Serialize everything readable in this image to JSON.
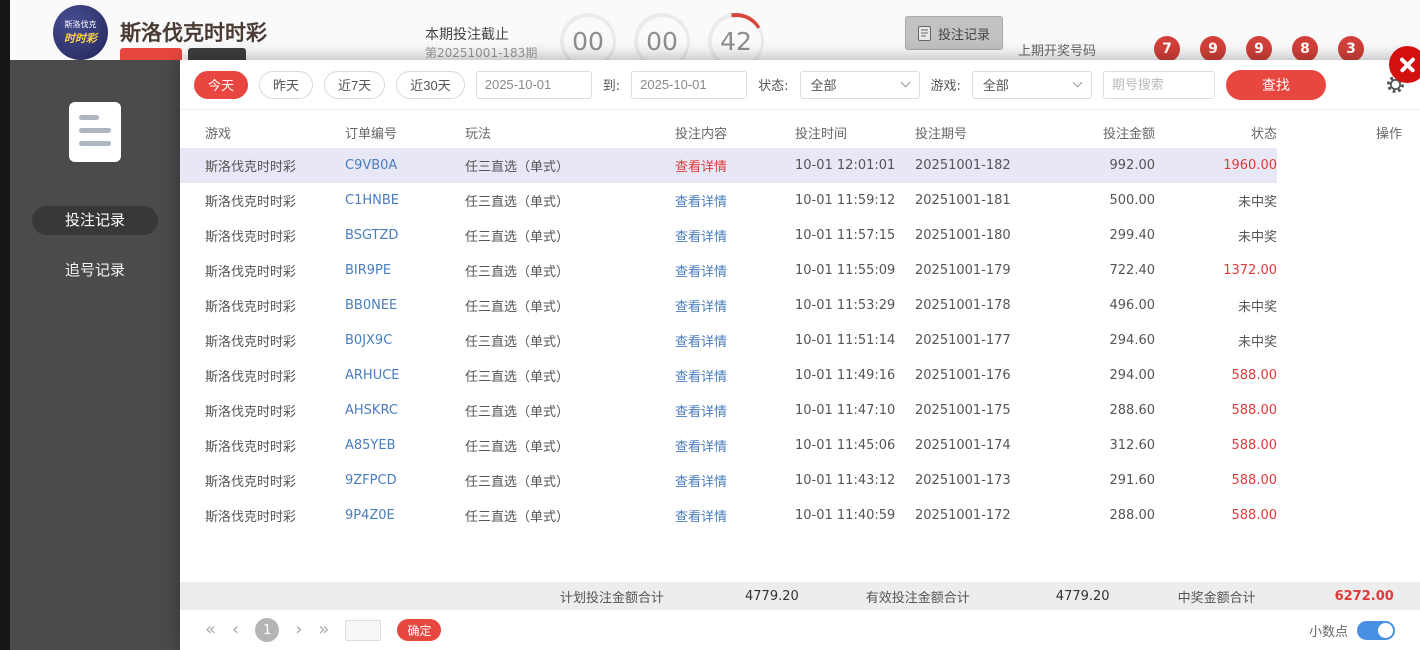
{
  "header": {
    "logo_line1": "斯洛伐克",
    "logo_line2": "时时彩",
    "title": "斯洛伐克时时彩",
    "deadline_label": "本期投注截止",
    "period_label": "第20251001-183期",
    "countdown": [
      "00",
      "00",
      "42"
    ],
    "bet_record_button": "投注记录",
    "last_draw_label": "上期开奖号码",
    "last_draw_numbers": [
      "7",
      "9",
      "9",
      "8",
      "3"
    ]
  },
  "sidebar": {
    "items": [
      {
        "label": "投注记录"
      },
      {
        "label": "追号记录"
      }
    ]
  },
  "filters": {
    "quick_buttons": [
      "今天",
      "昨天",
      "近7天",
      "近30天"
    ],
    "date_from": "2025-10-01",
    "to_label": "到:",
    "date_to": "2025-10-01",
    "status_label": "状态:",
    "status_value": "全部",
    "game_label": "游戏:",
    "game_value": "全部",
    "search_placeholder": "期号搜索",
    "search_button": "查找"
  },
  "table": {
    "columns": [
      "游戏",
      "订单编号",
      "玩法",
      "投注内容",
      "投注时间",
      "投注期号",
      "投注金额",
      "状态",
      "操作"
    ],
    "detail_link": "查看详情",
    "rows": [
      {
        "game": "斯洛伐克时时彩",
        "order": "C9VB0A",
        "play": "任三直选（单式）",
        "time": "10-01 12:01:01",
        "period": "20251001-182",
        "amount": "992.00",
        "status": "1960.00",
        "win": true,
        "highlight": true
      },
      {
        "game": "斯洛伐克时时彩",
        "order": "C1HNBE",
        "play": "任三直选（单式）",
        "time": "10-01 11:59:12",
        "period": "20251001-181",
        "amount": "500.00",
        "status": "未中奖",
        "win": false,
        "highlight": false
      },
      {
        "game": "斯洛伐克时时彩",
        "order": "BSGTZD",
        "play": "任三直选（单式）",
        "time": "10-01 11:57:15",
        "period": "20251001-180",
        "amount": "299.40",
        "status": "未中奖",
        "win": false,
        "highlight": false
      },
      {
        "game": "斯洛伐克时时彩",
        "order": "BIR9PE",
        "play": "任三直选（单式）",
        "time": "10-01 11:55:09",
        "period": "20251001-179",
        "amount": "722.40",
        "status": "1372.00",
        "win": true,
        "highlight": false
      },
      {
        "game": "斯洛伐克时时彩",
        "order": "BB0NEE",
        "play": "任三直选（单式）",
        "time": "10-01 11:53:29",
        "period": "20251001-178",
        "amount": "496.00",
        "status": "未中奖",
        "win": false,
        "highlight": false
      },
      {
        "game": "斯洛伐克时时彩",
        "order": "B0JX9C",
        "play": "任三直选（单式）",
        "time": "10-01 11:51:14",
        "period": "20251001-177",
        "amount": "294.60",
        "status": "未中奖",
        "win": false,
        "highlight": false
      },
      {
        "game": "斯洛伐克时时彩",
        "order": "ARHUCE",
        "play": "任三直选（单式）",
        "time": "10-01 11:49:16",
        "period": "20251001-176",
        "amount": "294.00",
        "status": "588.00",
        "win": true,
        "highlight": false
      },
      {
        "game": "斯洛伐克时时彩",
        "order": "AHSKRC",
        "play": "任三直选（单式）",
        "time": "10-01 11:47:10",
        "period": "20251001-175",
        "amount": "288.60",
        "status": "588.00",
        "win": true,
        "highlight": false
      },
      {
        "game": "斯洛伐克时时彩",
        "order": "A85YEB",
        "play": "任三直选（单式）",
        "time": "10-01 11:45:06",
        "period": "20251001-174",
        "amount": "312.60",
        "status": "588.00",
        "win": true,
        "highlight": false
      },
      {
        "game": "斯洛伐克时时彩",
        "order": "9ZFPCD",
        "play": "任三直选（单式）",
        "time": "10-01 11:43:12",
        "period": "20251001-173",
        "amount": "291.60",
        "status": "588.00",
        "win": true,
        "highlight": false
      },
      {
        "game": "斯洛伐克时时彩",
        "order": "9P4Z0E",
        "play": "任三直选（单式）",
        "time": "10-01 11:40:59",
        "period": "20251001-172",
        "amount": "288.00",
        "status": "588.00",
        "win": true,
        "highlight": false
      }
    ]
  },
  "summary": {
    "planned_label": "计划投注金额合计",
    "planned_value": "4779.20",
    "valid_label": "有效投注金额合计",
    "valid_value": "4779.20",
    "win_label": "中奖金额合计",
    "win_value": "6272.00"
  },
  "pagination": {
    "current_page": "1",
    "confirm_button": "确定",
    "decimal_label": "小数点"
  },
  "colors": {
    "accent_red": "#e8473f",
    "link_blue": "#4a7dbe",
    "win_red": "#e03b3b",
    "toggle_blue": "#4a90e2"
  }
}
